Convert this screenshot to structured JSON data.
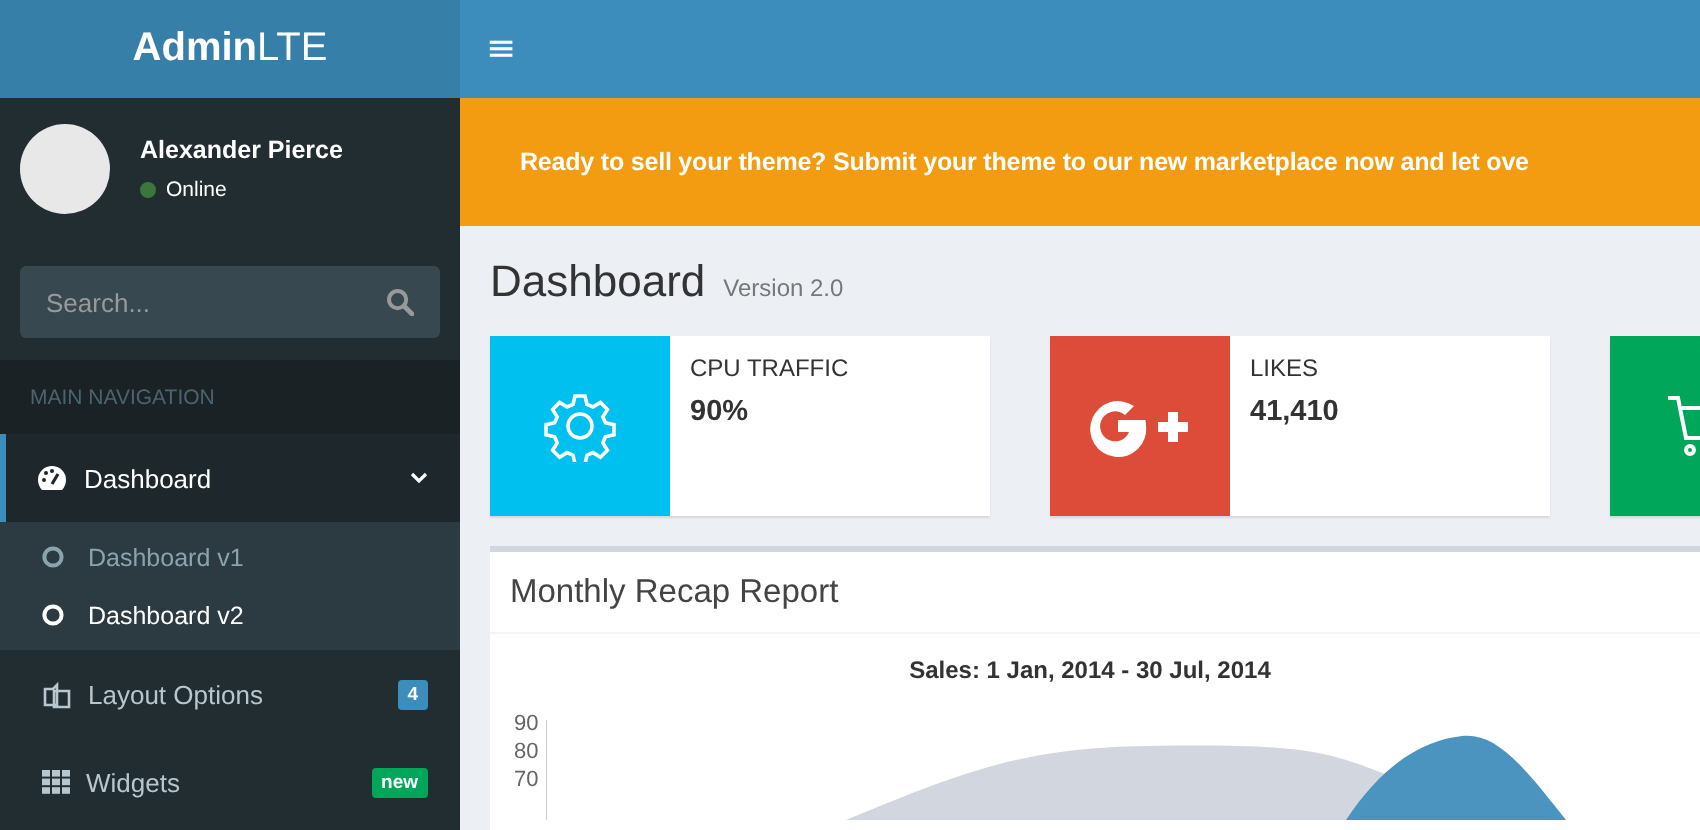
{
  "logo": "**Admin**LTE",
  "header": {
    "menu_toggle": "≡"
  },
  "user": {
    "name": "Alexander Pierce",
    "status": "Online",
    "online": true
  },
  "search": {
    "placeholder": "Search..."
  },
  "nav_header": "MAIN NAVIGATION",
  "nav": [
    {
      "label": "Dashboard",
      "kind": "dashboard",
      "selected": true,
      "expanded": true,
      "children": [
        {
          "label": "Dashboard v1",
          "selected": false
        },
        {
          "label": "Dashboard v2",
          "selected": true
        }
      ]
    },
    {
      "label": "Layout Options",
      "kind": "layout",
      "selected": false,
      "badge": {
        "text": "4",
        "color": "#3c8dbc"
      }
    },
    {
      "label": "Widgets",
      "kind": "widgets",
      "selected": false,
      "badge": {
        "text": "new",
        "color": "#00a65a"
      }
    }
  ],
  "banner": "Ready to sell your theme? Submit your theme to our new marketplace now and let ove",
  "page_title": "Dashboard",
  "page_subtitle": "Version 2.0",
  "info_boxes": [
    {
      "kind": "cpu",
      "color": "#00c0ef",
      "label": "CPU TRAFFIC",
      "value": "90%"
    },
    {
      "kind": "likes",
      "color": "#dd4b39",
      "label": "LIKES",
      "value": "41,410"
    },
    {
      "kind": "cart",
      "color": "#00a65a"
    }
  ],
  "report": {
    "title": "Monthly Recap Report",
    "chart_title": "Sales: 1 Jan, 2014 - 30 Jul, 2014",
    "y_ticks": [
      "90",
      "80",
      "70"
    ]
  }
}
